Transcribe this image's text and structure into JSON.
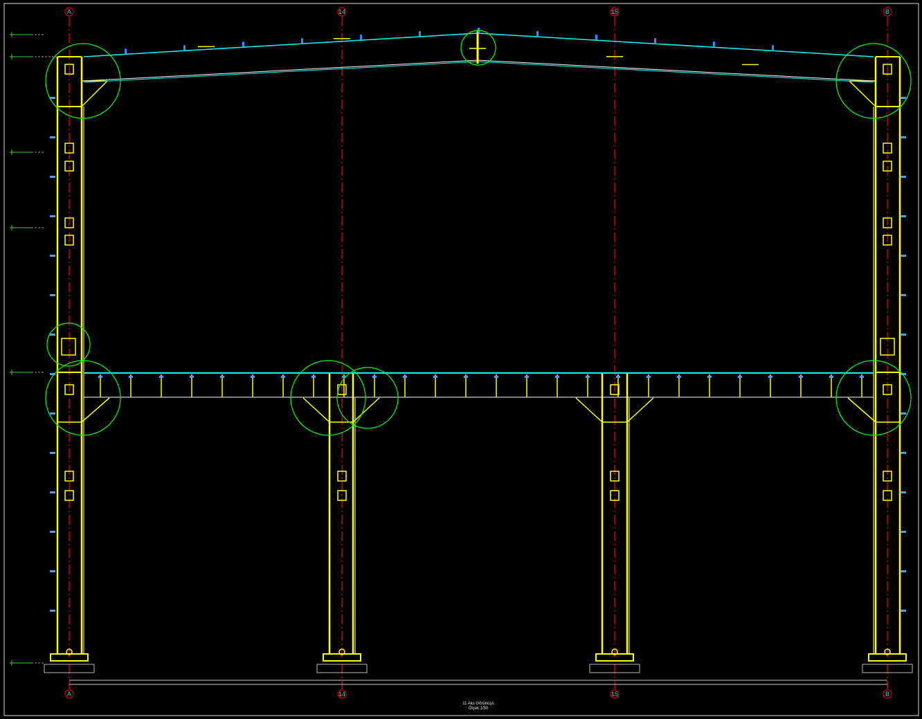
{
  "drawing": {
    "title": "11 Aks Görünüşü",
    "scale": "Ölçek:1/50"
  },
  "axes": [
    {
      "label": "A"
    },
    {
      "label": "14"
    },
    {
      "label": "15"
    },
    {
      "label": "B"
    }
  ],
  "colors": {
    "background": "#000000",
    "axis_line": "#ff0000",
    "steel": "#ffff00",
    "purlin": "#00ffff",
    "detail_circle": "#00ff00",
    "secondary": "#ffffff",
    "level_marker": "#2e8b2e"
  }
}
